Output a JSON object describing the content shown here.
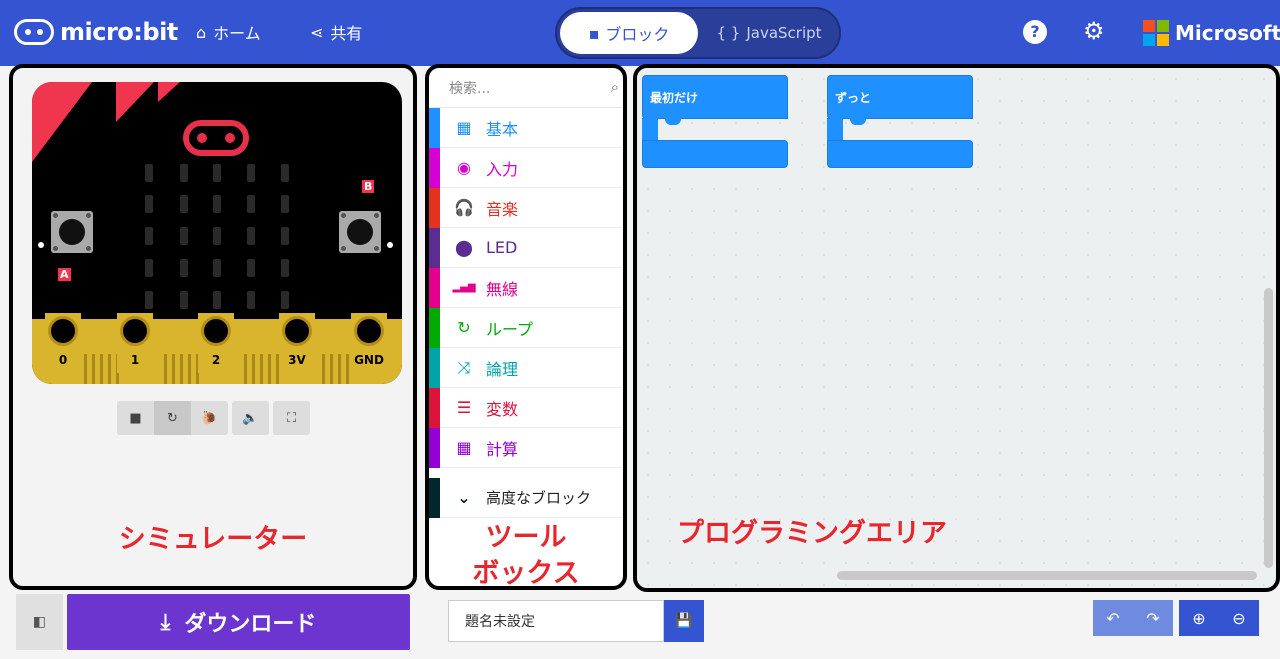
{
  "header": {
    "logo_text": "micro:bit",
    "nav_home": "ホーム",
    "nav_share": "共有",
    "mode_blocks": "ブロック",
    "mode_js": "JavaScript",
    "brand": "Microsoft",
    "help_glyph": "?",
    "brand_colors": [
      "#f25022",
      "#7fba00",
      "#00a4ef",
      "#ffb900"
    ]
  },
  "simulator": {
    "button_a": "A",
    "button_b": "B",
    "pins": [
      "0",
      "1",
      "2",
      "3V",
      "GND"
    ],
    "controls": {
      "stop": "■",
      "restart": "↻",
      "slowmo": "🐌",
      "mute": "🔈",
      "fullscreen": "⛶"
    }
  },
  "toolbox": {
    "search_placeholder": "検索...",
    "categories": [
      {
        "label": "基本",
        "color": "#1e90ff",
        "icon": "grid-icon",
        "glyph": "▦"
      },
      {
        "label": "入力",
        "color": "#d400d4",
        "icon": "target-icon",
        "glyph": "◉"
      },
      {
        "label": "音楽",
        "color": "#e63022",
        "icon": "headphones-icon",
        "glyph": "🎧"
      },
      {
        "label": "LED",
        "color": "#5c2d91",
        "icon": "toggle-icon",
        "glyph": "⬤"
      },
      {
        "label": "無線",
        "color": "#e3008c",
        "icon": "signal-icon",
        "glyph": "▂▄▆"
      },
      {
        "label": "ループ",
        "color": "#00aa00",
        "icon": "refresh-icon",
        "glyph": "↻"
      },
      {
        "label": "論理",
        "color": "#00a4a6",
        "icon": "shuffle-icon",
        "glyph": "⤨"
      },
      {
        "label": "変数",
        "color": "#dc143c",
        "icon": "list-icon",
        "glyph": "☰"
      },
      {
        "label": "計算",
        "color": "#9400d3",
        "icon": "calculator-icon",
        "glyph": "▦"
      },
      {
        "label": "高度なブロック",
        "color": "#00272b",
        "icon": "chevron-down-icon",
        "glyph": "⌄"
      }
    ]
  },
  "workspace": {
    "block_on_start": "最初だけ",
    "block_forever": "ずっと",
    "block_color": "#1e90ff"
  },
  "annotations": {
    "simulator": "シミュレーター",
    "toolbox_line1": "ツール",
    "toolbox_line2": "ボックス",
    "workspace": "プログラミングエリア",
    "color": "#e8262d"
  },
  "bottom": {
    "download_label": "ダウンロード",
    "project_name": "題名未設定",
    "project_name_placeholder": "題名未設定"
  }
}
